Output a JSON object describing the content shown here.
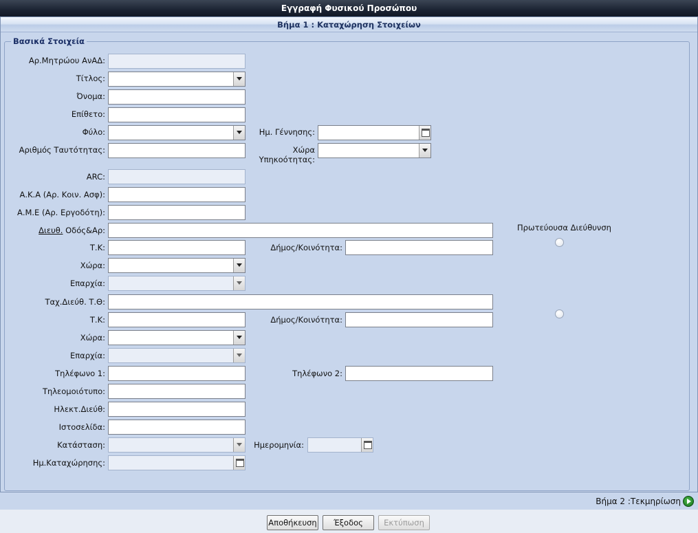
{
  "window": {
    "title": "Εγγραφή Φυσικού Προσώπου"
  },
  "step_bar": {
    "label": "Βήμα 1 : Καταχώρηση Στοιχείων"
  },
  "basic_section": {
    "legend": "Βασικά Στοιχεία"
  },
  "form": {
    "registry_no": {
      "label": "Αρ.Μητρώου ΑνΑΔ:",
      "value": ""
    },
    "title": {
      "label": "Τίτλος:",
      "value": ""
    },
    "first_name": {
      "label": "Όνομα:",
      "value": ""
    },
    "last_name": {
      "label": "Επίθετο:",
      "value": ""
    },
    "gender": {
      "label": "Φύλο:",
      "value": ""
    },
    "birth_date": {
      "label": "Ημ. Γέννησης:",
      "value": ""
    },
    "id_number": {
      "label": "Αριθμός Ταυτότητας:",
      "value": ""
    },
    "citizenship": {
      "label_line1": "Χώρα",
      "label_line2": "Υπηκοότητας:",
      "value": ""
    },
    "arc": {
      "label": "ARC:",
      "value": ""
    },
    "social_insurance": {
      "label": "Α.Κ.Α (Αρ. Κοιν. Ασφ):",
      "value": ""
    },
    "employer_no": {
      "label": "Α.Μ.Ε (Αρ. Εργοδότη):",
      "value": ""
    },
    "address": {
      "label_link": "Διευθ.",
      "label_rest": " Οδός&Αρ:",
      "value": ""
    },
    "primary_address_label": "Πρωτεύουσα Διεύθυνση",
    "postal_code_1": {
      "label": "Τ.Κ:",
      "value": ""
    },
    "municipality_1": {
      "label": "Δήμος/Κοινότητα:",
      "value": ""
    },
    "country_1": {
      "label": "Χώρα:",
      "value": ""
    },
    "district_1": {
      "label": "Επαρχία:",
      "value": ""
    },
    "po_box": {
      "label": "Ταχ.Διεύθ. Τ.Θ:",
      "value": ""
    },
    "postal_code_2": {
      "label": "Τ.Κ:",
      "value": ""
    },
    "municipality_2": {
      "label": "Δήμος/Κοινότητα:",
      "value": ""
    },
    "country_2": {
      "label": "Χώρα:",
      "value": ""
    },
    "district_2": {
      "label": "Επαρχία:",
      "value": ""
    },
    "phone_1": {
      "label": "Τηλέφωνο 1:",
      "value": ""
    },
    "phone_2": {
      "label": "Τηλέφωνο 2:",
      "value": ""
    },
    "fax": {
      "label": "Τηλεομοιότυπο:",
      "value": ""
    },
    "email": {
      "label": "Ηλεκτ.Διεύθ:",
      "value": ""
    },
    "website": {
      "label": "Ιστοσελίδα:",
      "value": ""
    },
    "status": {
      "label": "Κατάσταση:",
      "value": ""
    },
    "status_date": {
      "label": "Ημερομηνία:",
      "value": ""
    },
    "registration_date": {
      "label": "Ημ.Καταχώρησης:",
      "value": ""
    }
  },
  "next_step": {
    "label": "Βήμα 2 :Τεκμηρίωση"
  },
  "buttons": {
    "save": "Αποθήκευση",
    "exit": "Έξοδος",
    "print": "Εκτύπωση"
  }
}
